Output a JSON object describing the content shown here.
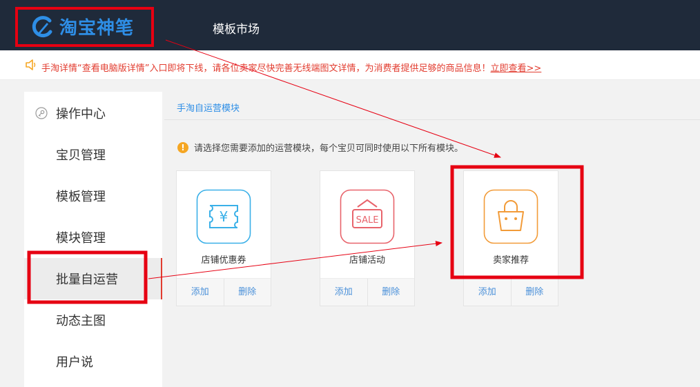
{
  "header": {
    "logo_text": "淘宝神笔",
    "nav_market": "模板市场"
  },
  "notice": {
    "text": "手淘详情“查看电脑版详情”入口即将下线，请各位卖家尽快完善无线端图文详情，为消费者提供足够的商品信息！",
    "link": "立即查看>>"
  },
  "sidebar": {
    "items": [
      {
        "label": "操作中心"
      },
      {
        "label": "宝贝管理"
      },
      {
        "label": "模板管理"
      },
      {
        "label": "模块管理"
      },
      {
        "label": "批量自运营"
      },
      {
        "label": "动态主图"
      },
      {
        "label": "用户说"
      }
    ]
  },
  "main": {
    "breadcrumb": "手淘自运营模块",
    "hint_icon": "!",
    "hint": "请选择您需要添加的运营模块，每个宝贝可同时使用以下所有模块。",
    "coupon_symbol": "¥",
    "sale_text": "SALE",
    "cards": [
      {
        "title": "店铺优惠券",
        "add": "添加",
        "delete": "删除"
      },
      {
        "title": "店铺活动",
        "add": "添加",
        "delete": "删除"
      },
      {
        "title": "卖家推荐",
        "add": "添加",
        "delete": "删除"
      }
    ]
  },
  "colors": {
    "header_bg": "#1f2a3a",
    "accent_blue": "#2e8ee6",
    "notice_red": "#e23c2f",
    "coupon_blue": "#3ab0e8",
    "sale_red": "#e8636b",
    "recommend_orange": "#f29b38",
    "annotation_red": "#e60012"
  }
}
